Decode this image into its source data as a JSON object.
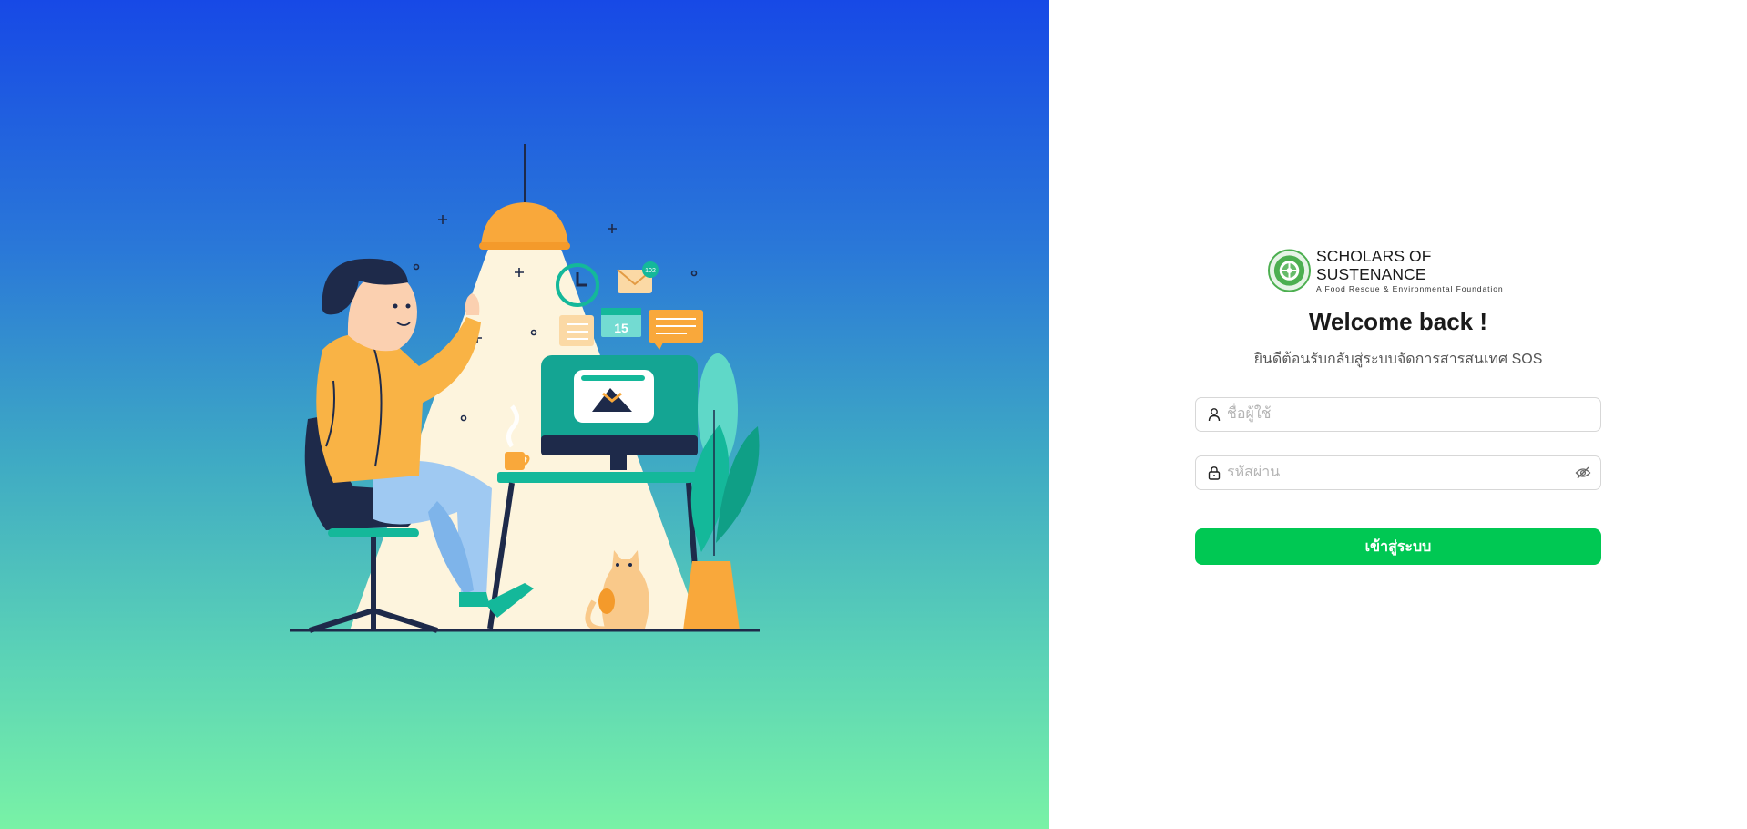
{
  "brand": {
    "name": "SCHOLARS OF SUSTENANCE",
    "tagline": "A Food Rescue & Environmental Foundation",
    "color": "#4caf50"
  },
  "login": {
    "title": "Welcome back !",
    "subtitle": "ยินดีต้อนรับกลับสู่ระบบจัดการสารสนเทศ SOS",
    "username": {
      "placeholder": "ชื่อผู้ใช้",
      "value": "",
      "icon": "user-icon"
    },
    "password": {
      "placeholder": "รหัสผ่าน",
      "value": "",
      "icon": "lock-icon",
      "toggle_icon": "eye-off-icon"
    },
    "submit_label": "เข้าสู่ระบบ",
    "button_color": "#00c853"
  },
  "illustration": {
    "calendar_day": "15",
    "mail_badge": "102"
  },
  "colors": {
    "gradient_top": "#1749e6",
    "gradient_bottom": "#79f2a6"
  }
}
